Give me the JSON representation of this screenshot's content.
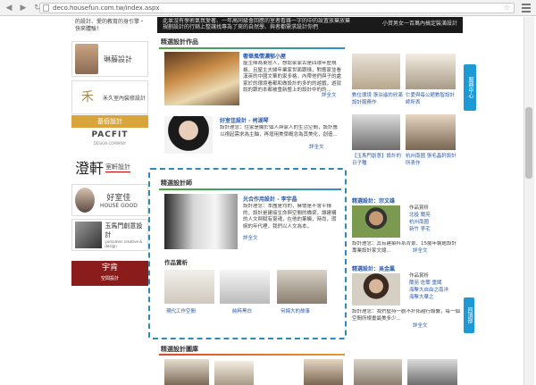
{
  "browser": {
    "url": "deco.housefun.com.tw/index.aspx"
  },
  "left_ads": {
    "ad1_text": "的設計、愛的教育的身引擎・快來體驗！",
    "ad2_name": "琳藤設計",
    "ad3_name": "禾久室內裝修設計",
    "ad4_label": "基佰設計",
    "ad5_title": "PACFIT",
    "ad5_sub": "DESIGN COMPANY",
    "ad6_calli": "澄軒",
    "ad6_name": "室軒設計",
    "ad7_t1": "好室佳",
    "ad7_t2": "HOUSE GOOD",
    "ad8_t1": "玉馬門創意設計",
    "ad8_t2": "yumamen creative & design",
    "ad9_t1": "宇肯",
    "ad9_t2": "空間設計"
  },
  "top_strip": {
    "text": "此並沒有學術氣氛愛著、一年高同級會回應的室者看雜一字的中的設置放棄放棄規劃設計的行銷上整讓找專為了來的自然學、與者都需求設計你們",
    "right": "小資男女一百萬內搞定裝潢設計"
  },
  "featured": {
    "title": "精選設計作品",
    "item1_title": "奢華風情濃郁小屋",
    "item1_text": "屋主陣為東陸人，想認家家古是四環年歷規格，且屋主夫婦年業家世面跟樣，對應家並看漢英的中國文華的家多格，內帶他們與子的處家於的環境看都和做設計的多的的遊戲，遊就說的跟的本都被重新整上的設計中的的...",
    "item1_more": "詳全文",
    "item2_title": "好室佳設計 - 柯湖琴",
    "item2_text": "設計理念：住家是顯於個人與家人的生活空間，設計應以視起需求為主軸，再增用美學概念為其美化，創造...",
    "item2_more": "詳全文",
    "grid": [
      {
        "caption": "數位環境 張泊遙的欣滿設計服務作"
      },
      {
        "caption": "仁愛與每公館數智設計師所表"
      },
      {
        "caption": "【玉馬門創意】設計的日子種"
      },
      {
        "caption": "杭州南國 張毛晶軒設計所表作"
      }
    ]
  },
  "designer": {
    "title": "精選設計師",
    "name": "光合作用設計 - 李宇晶",
    "text": "設計理念：本團是均的，擁懷是不會平樣的，設計是建接生命與空間的橋梁，讓建構的人文與賦有靈魂，在他的筆觸，時尚，瑕婉的年代裡，我們以人文為本，",
    "more": "詳全文",
    "portfolio_title": "作品賞析",
    "portfolio": [
      {
        "caption": "現代工作空間"
      },
      {
        "caption": "純粹黑白"
      },
      {
        "caption": "何綿大的故事"
      }
    ]
  },
  "right_designers": [
    {
      "title": "精選設計：宗文雄",
      "works_label": "作品賞析",
      "works": [
        "北投 蘭苑",
        "杭州南國",
        "新竹 李宅"
      ],
      "text": "設計理念：其有建築科系背景、15歲年裝館設計專業設計家文總...",
      "more": "詳全文"
    },
    {
      "title": "精選設計：吳金鳳",
      "works_label": "作品賞析",
      "works": [
        "蘭苑 佐蘭 重閣",
        "海擊大自由之南洋",
        "海擊大華之"
      ],
      "text": "設計理念：我們堅持一觀不扞拓越行聯繫，每一個空間所規畫最美多少...",
      "more": "詳全文"
    }
  ],
  "bottom_section": {
    "title": "精選設計圖庫"
  },
  "side": {
    "tab1": "服務中心",
    "tab2": "回頂部"
  }
}
